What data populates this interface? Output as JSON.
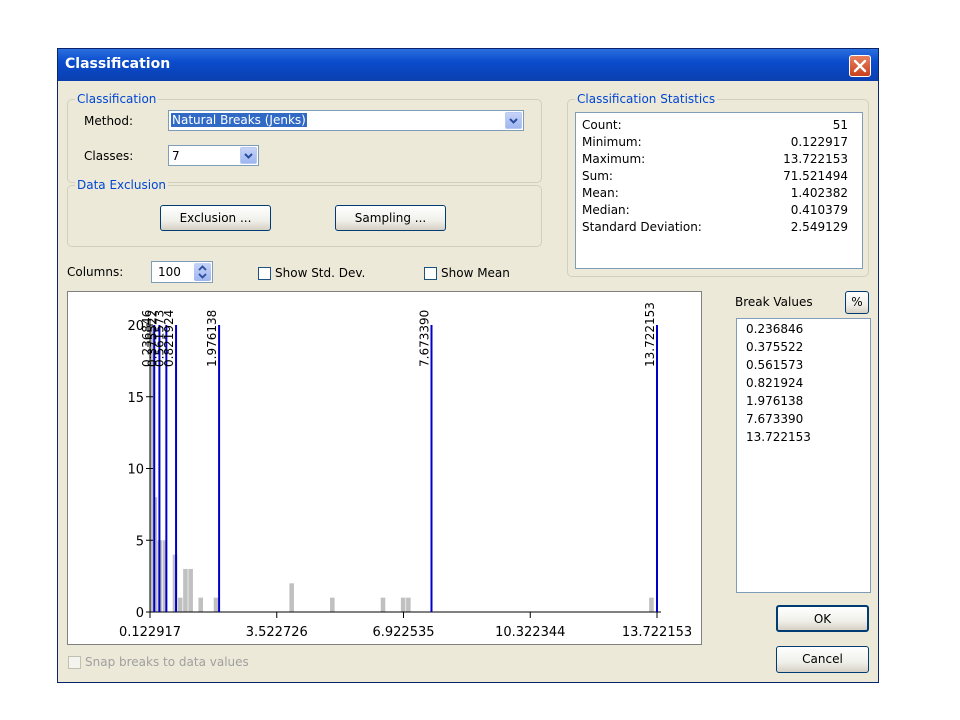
{
  "dialog": {
    "title": "Classification",
    "close_icon": "close-icon"
  },
  "classification": {
    "group_label": "Classification",
    "method_label": "Method:",
    "method_value": "Natural Breaks (Jenks)",
    "classes_label": "Classes:",
    "classes_value": "7"
  },
  "data_exclusion": {
    "group_label": "Data Exclusion",
    "exclusion_button": "Exclusion ...",
    "sampling_button": "Sampling ..."
  },
  "stats": {
    "group_label": "Classification Statistics",
    "rows": [
      {
        "label": "Count:",
        "value": "51"
      },
      {
        "label": "Minimum:",
        "value": "0.122917"
      },
      {
        "label": "Maximum:",
        "value": "13.722153"
      },
      {
        "label": "Sum:",
        "value": "71.521494"
      },
      {
        "label": "Mean:",
        "value": "1.402382"
      },
      {
        "label": "Median:",
        "value": "0.410379"
      },
      {
        "label": "Standard Deviation:",
        "value": "2.549129"
      }
    ]
  },
  "columns": {
    "label": "Columns:",
    "value": "100",
    "show_std_dev": "Show Std. Dev.",
    "show_mean": "Show Mean"
  },
  "breaks": {
    "label": "Break Values",
    "percent_button": "%",
    "values": [
      "0.236846",
      "0.375522",
      "0.561573",
      "0.821924",
      "1.976138",
      "7.673390",
      "13.722153"
    ]
  },
  "buttons": {
    "ok": "OK",
    "cancel": "Cancel"
  },
  "snap": {
    "label": "Snap breaks to data values"
  },
  "colors": {
    "break_line": "#0000c8",
    "histogram_bar": "#c0c0c0",
    "legend_text": "#0046d5"
  },
  "chart_data": {
    "type": "bar",
    "xlim": [
      0.122917,
      13.722153
    ],
    "ylim": [
      0,
      20
    ],
    "x_ticks": [
      "0.122917",
      "3.522726",
      "6.922535",
      "10.322344",
      "13.722153"
    ],
    "y_ticks": [
      "0",
      "5",
      "10",
      "15",
      "20"
    ],
    "break_labels": [
      "0.236846",
      "0.375522",
      "0.561573",
      "0.821924",
      "1.976138",
      "7.673390",
      "13.722153"
    ],
    "break_values": [
      0.236846,
      0.375522,
      0.561573,
      0.821924,
      1.976138,
      7.67339,
      13.722153
    ],
    "bins": [
      {
        "x": 0.19,
        "count": 20
      },
      {
        "x": 0.26,
        "count": 8
      },
      {
        "x": 0.39,
        "count": 5
      },
      {
        "x": 0.53,
        "count": 5
      },
      {
        "x": 0.8,
        "count": 4
      },
      {
        "x": 0.94,
        "count": 1
      },
      {
        "x": 1.08,
        "count": 3
      },
      {
        "x": 1.22,
        "count": 3
      },
      {
        "x": 1.49,
        "count": 1
      },
      {
        "x": 1.9,
        "count": 1
      },
      {
        "x": 3.93,
        "count": 2
      },
      {
        "x": 5.02,
        "count": 1
      },
      {
        "x": 6.38,
        "count": 1
      },
      {
        "x": 6.92,
        "count": 1
      },
      {
        "x": 7.06,
        "count": 1
      },
      {
        "x": 13.58,
        "count": 1
      }
    ]
  }
}
